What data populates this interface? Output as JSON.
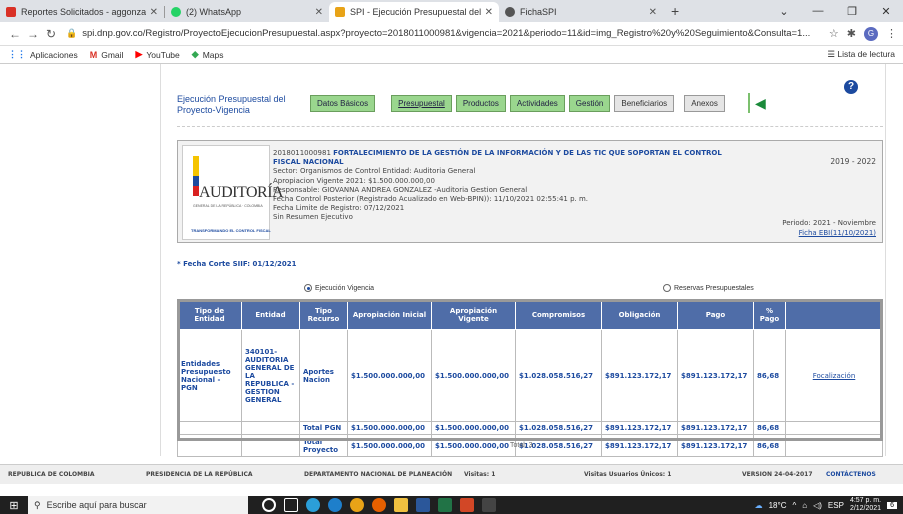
{
  "browser": {
    "tabs": [
      {
        "label": "Reportes Solicitados - aggonzale",
        "icon": "gmail-icon",
        "color": "#d93025"
      },
      {
        "label": "(2) WhatsApp",
        "icon": "whatsapp-icon",
        "color": "#25d366"
      },
      {
        "label": "SPI - Ejecución Presupuestal del",
        "icon": "spi-icon",
        "color": "#e8a317"
      },
      {
        "label": "FichaSPI",
        "icon": "globe-icon",
        "color": "#555555"
      }
    ],
    "url": "spi.dnp.gov.co/Registro/ProyectoEjecucionPresupuestal.aspx?proyecto=2018011000981&vigencia=2021&periodo=11&id=img_Registro%20y%20Seguimiento&Consulta=1...",
    "bookmarks": [
      "Aplicaciones",
      "Gmail",
      "YouTube",
      "Maps"
    ],
    "reading_list": "Lista de lectura"
  },
  "page": {
    "title": "Ejecución Presupuestal del Proyecto-Vigencia",
    "nav_buttons": [
      "Datos Básicos",
      "Presupuestal",
      "Productos",
      "Actividades",
      "Gestión",
      "Beneficiarios",
      "Anexos"
    ],
    "project": {
      "code_title_code": "2018011000981",
      "code_title": "FORTALECIMIENTO DE LA GESTIÓN DE LA INFORMACIÓN Y DE LAS TIC QUE SOPORTAN EL CONTROL FISCAL NACIONAL",
      "sector": "Sector: Organismos de Control Entidad: Auditoria General",
      "apropiacion": "Apropiacion Vigente 2021: $1.500.000.000,00",
      "responsable": "Responsable: GIOVANNA ANDREA GONZALEZ -Auditoria Gestion General",
      "fecha_control": "Fecha Control Posterior (Registrado Acualizado en Web-BPIN)): 11/10/2021 02:55:41 p. m.",
      "fecha_limite": "Fecha Limite de Registro: 07/12/2021",
      "resumen": "Sin Resumen Ejecutivo",
      "range": "2019 - 2022",
      "periodo": "Periodo: 2021 - Noviembre",
      "ficha": "Ficha EBI(11/10/2021)"
    },
    "logo": {
      "name": "AUDITORÍA",
      "sub": "GENERAL DE LA REPÚBLICA · COLOMBIA",
      "slogan": "TRANSFORMANDO EL CONTROL FISCAL"
    },
    "fecha_corte": "* Fecha Corte SIIF: 01/12/2021",
    "radio_vigencia": "Ejecución Vigencia",
    "radio_reservas": "Reservas Presupuestales",
    "table": {
      "headers": [
        "Tipo de Entidad",
        "Entidad",
        "Tipo Recurso",
        "Apropiación Inicial",
        "Apropiación Vigente",
        "Compromisos",
        "Obligación",
        "Pago",
        "% Pago",
        ""
      ],
      "row": {
        "tipo": "Entidades Presupuesto Nacional - PGN",
        "entidad": "340101-AUDITORIA GENERAL DE LA REPUBLICA - GESTION GENERAL",
        "recurso": "Aportes Nacion",
        "inicial": "$1.500.000.000,00",
        "vigente": "$1.500.000.000,00",
        "compromisos": "$1.028.058.516,27",
        "obligacion": "$891.123.172,17",
        "pago": "$891.123.172,17",
        "pct": "86,68",
        "link": "Focalización"
      },
      "total_pgn": {
        "label": "Total PGN",
        "inicial": "$1.500.000.000,00",
        "vigente": "$1.500.000.000,00",
        "compromisos": "$1.028.058.516,27",
        "obligacion": "$891.123.172,17",
        "pago": "$891.123.172,17",
        "pct": "86,68"
      },
      "total_proyecto": {
        "label": "Total Proyecto",
        "inicial": "$1.500.000.000,00",
        "vigente": "$1.500.000.000,00",
        "compromisos": "$1.028.058.516,27",
        "obligacion": "$891.123.172,17",
        "pago": "$891.123.172,17",
        "pct": "86,68"
      },
      "total_count": "Total: 3"
    },
    "footer": [
      "REPUBLICA DE COLOMBIA",
      "PRESIDENCIA DE LA REPÚBLICA",
      "DEPARTAMENTO NACIONAL DE PLANEACIÓN",
      "Visitas: 1",
      "Visitas Usuarios Únicos: 1",
      "VERSION 24-04-2017",
      "CONTÁCTENOS"
    ]
  },
  "taskbar": {
    "search": "Escribe aquí para buscar",
    "weather": "18°C",
    "lang": "ESP",
    "time": "4:57 p. m.",
    "date": "2/12/2021",
    "notif": "6"
  }
}
